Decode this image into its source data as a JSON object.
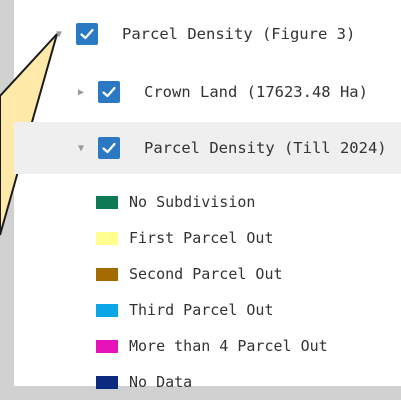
{
  "layers": {
    "root": {
      "label": "Parcel Density (Figure 3)",
      "expanded": true,
      "checked": true
    },
    "crown": {
      "label": "Crown Land (17623.48 Ha)",
      "expanded": false,
      "checked": true
    },
    "density": {
      "label": "Parcel Density (Till 2024)",
      "expanded": true,
      "checked": true
    }
  },
  "legend": [
    {
      "label": "No Subdivision",
      "color": "#0e7a55"
    },
    {
      "label": "First Parcel Out",
      "color": "#ffff8f"
    },
    {
      "label": "Second Parcel Out",
      "color": "#a36b00"
    },
    {
      "label": "Third Parcel Out",
      "color": "#0aa6e6"
    },
    {
      "label": "More than 4 Parcel Out",
      "color": "#e614b8"
    },
    {
      "label": "No Data",
      "color": "#0b2b80"
    }
  ],
  "colors": {
    "checkbox": "#2b79c2",
    "callout_fill": "#ffe9a8",
    "selected_row": "#efefef"
  }
}
